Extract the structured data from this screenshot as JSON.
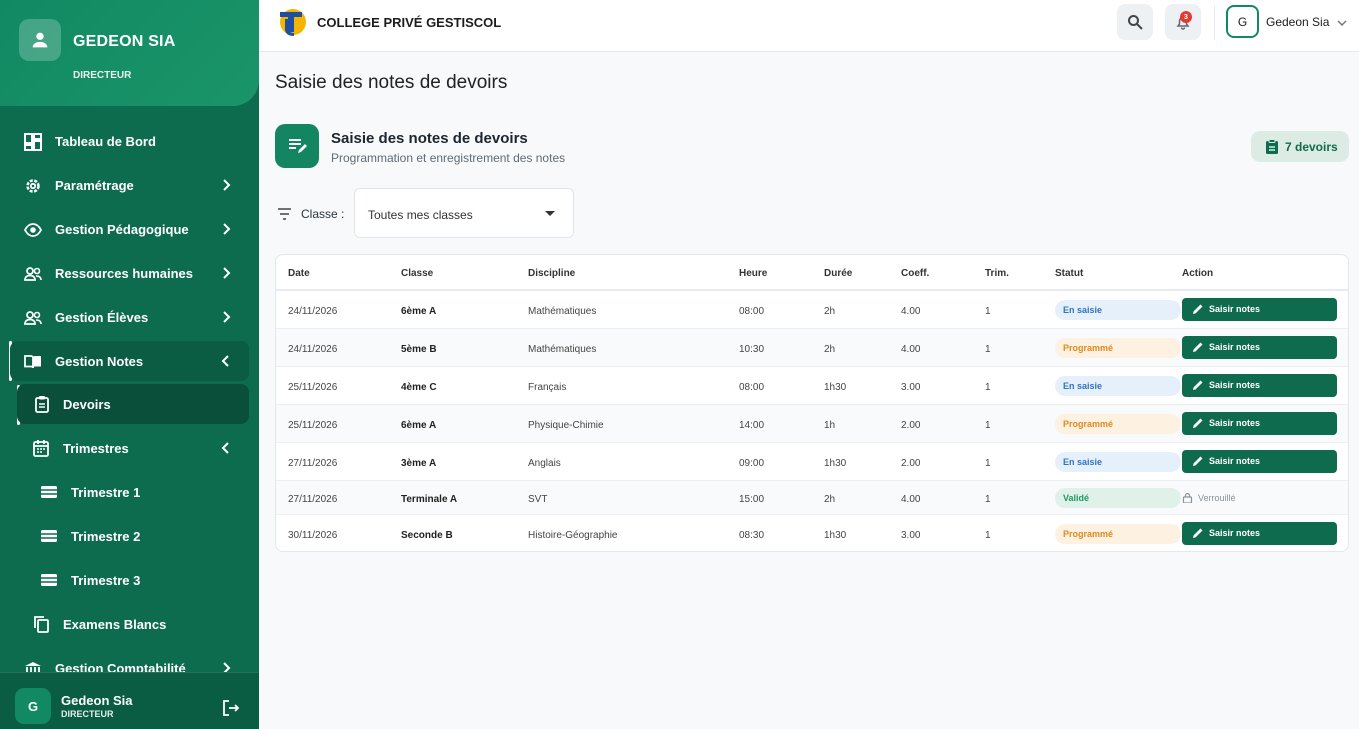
{
  "sidebar": {
    "profile": {
      "name": "GEDEON SIA",
      "role": "DIRECTEUR"
    },
    "items": [
      {
        "label": "Tableau de Bord",
        "icon": "dashboard-icon"
      },
      {
        "label": "Paramétrage",
        "icon": "gear-icon"
      },
      {
        "label": "Gestion Pédagogique",
        "icon": "eye-icon"
      },
      {
        "label": "Ressources humaines",
        "icon": "people-icon"
      },
      {
        "label": "Gestion Élèves",
        "icon": "people-icon"
      },
      {
        "label": "Gestion Notes",
        "icon": "book-icon"
      },
      {
        "label": "Gestion Comptabilité",
        "icon": "bank-icon"
      }
    ],
    "sub": {
      "devoirs": "Devoirs",
      "trimestres": "Trimestres",
      "trimestre1": "Trimestre 1",
      "trimestre2": "Trimestre 2",
      "trimestre3": "Trimestre 3",
      "examens": "Examens Blancs"
    },
    "footer": {
      "avatar": "G",
      "name": "Gedeon Sia",
      "role": "DIRECTEUR"
    }
  },
  "topbar": {
    "school": "COLLEGE PRIVÉ GESTISCOL",
    "notifications": "3",
    "user_initial": "G",
    "user_name": "Gedeon Sia"
  },
  "page": {
    "title": "Saisie des notes de devoirs",
    "header_title": "Saisie des notes de devoirs",
    "header_subtitle": "Programmation et enregistrement des notes",
    "count_label": "7 devoirs"
  },
  "filter": {
    "label": "Classe :",
    "value": "Toutes mes classes"
  },
  "table": {
    "columns": [
      "Date",
      "Classe",
      "Discipline",
      "Heure",
      "Durée",
      "Coeff.",
      "Trim.",
      "Statut",
      "Action"
    ],
    "rows": [
      {
        "date": "24/11/2026",
        "classe": "6ème A",
        "discipline": "Mathématiques",
        "heure": "08:00",
        "duree": "2h",
        "coeff": "4.00",
        "trim": "1",
        "statut": "En saisie",
        "action": "Saisir notes"
      },
      {
        "date": "24/11/2026",
        "classe": "5ème B",
        "discipline": "Mathématiques",
        "heure": "10:30",
        "duree": "2h",
        "coeff": "4.00",
        "trim": "1",
        "statut": "Programmé",
        "action": "Saisir notes"
      },
      {
        "date": "25/11/2026",
        "classe": "4ème C",
        "discipline": "Français",
        "heure": "08:00",
        "duree": "1h30",
        "coeff": "3.00",
        "trim": "1",
        "statut": "En saisie",
        "action": "Saisir notes"
      },
      {
        "date": "25/11/2026",
        "classe": "6ème A",
        "discipline": "Physique-Chimie",
        "heure": "14:00",
        "duree": "1h",
        "coeff": "2.00",
        "trim": "1",
        "statut": "Programmé",
        "action": "Saisir notes"
      },
      {
        "date": "27/11/2026",
        "classe": "3ème A",
        "discipline": "Anglais",
        "heure": "09:00",
        "duree": "1h30",
        "coeff": "2.00",
        "trim": "1",
        "statut": "En saisie",
        "action": "Saisir notes"
      },
      {
        "date": "27/11/2026",
        "classe": "Terminale A",
        "discipline": "SVT",
        "heure": "15:00",
        "duree": "2h",
        "coeff": "4.00",
        "trim": "1",
        "statut": "Validé",
        "action": "Verrouillé"
      },
      {
        "date": "30/11/2026",
        "classe": "Seconde B",
        "discipline": "Histoire-Géographie",
        "heure": "08:30",
        "duree": "1h30",
        "coeff": "3.00",
        "trim": "1",
        "statut": "Programmé",
        "action": "Saisir notes"
      }
    ]
  },
  "colors": {
    "primary": "#0d6b4e",
    "accent": "#138561",
    "saisie": "#2f73c9",
    "programme": "#e08a1e",
    "valide": "#1f9a63"
  }
}
